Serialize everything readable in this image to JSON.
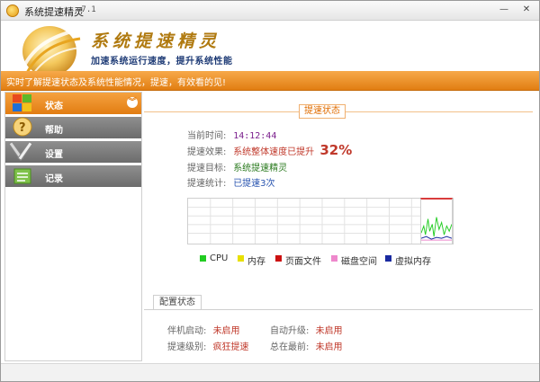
{
  "window": {
    "title": "系统提速精灵",
    "version": "v7.1",
    "minimize_glyph": "—",
    "close_glyph": "✕"
  },
  "header": {
    "brand_title": "系统提速精灵",
    "brand_subtitle": "加速系统运行速度，提升系统性能"
  },
  "notice": "实时了解提速状态及系统性能情况，提速，有效看的见!",
  "sidebar": {
    "items": [
      {
        "label": "状态",
        "icon": "windows-logo-icon",
        "active": true
      },
      {
        "label": "帮助",
        "icon": "help-icon",
        "active": false
      },
      {
        "label": "设置",
        "icon": "tools-icon",
        "active": false
      },
      {
        "label": "记录",
        "icon": "record-icon",
        "active": false
      }
    ],
    "chevron_glyph": "︾"
  },
  "status": {
    "section_title": "提速状态",
    "time_label": "当前时间:",
    "time_value": "14:12:44",
    "effect_label": "提速效果:",
    "effect_value": "系统整体速度已提升",
    "effect_percent": "32%",
    "target_label": "提速目标:",
    "target_value": "系统提速精灵",
    "stats_label": "提速统计:",
    "stats_value": "已提速3次"
  },
  "legend": [
    {
      "label": "CPU",
      "color": "#22cc22"
    },
    {
      "label": "内存",
      "color": "#e8e000"
    },
    {
      "label": "页面文件",
      "color": "#cc1111"
    },
    {
      "label": "磁盘空间",
      "color": "#ee88cc"
    },
    {
      "label": "虚拟内存",
      "color": "#1a2aa0"
    }
  ],
  "config": {
    "tab_label": "配置状态",
    "boot_label": "伴机启动:",
    "boot_value": "未启用",
    "autoupdate_label": "自动升级:",
    "autoupdate_value": "未启用",
    "level_label": "提速级别:",
    "level_value": "疯狂提速",
    "ontop_label": "总在最前:",
    "ontop_value": "未启用"
  },
  "colors": {
    "accent_orange": "#e27d12",
    "sidebar_gray": "#7a7a7a",
    "value_red": "#c0392b"
  }
}
